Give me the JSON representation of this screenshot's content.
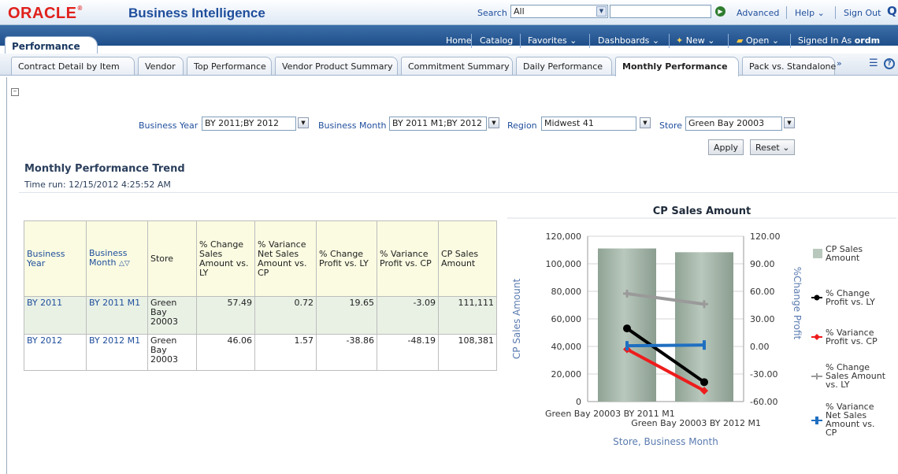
{
  "header": {
    "logo": "ORACLE",
    "logo_mark": "®",
    "title": "Business Intelligence",
    "search_label": "Search",
    "search_scope": "All",
    "links": [
      "Advanced",
      "Help ⌄",
      "Sign Out"
    ]
  },
  "nav": {
    "dashboard_tab": "Performance",
    "links": [
      "Home",
      "Catalog",
      "Favorites ⌄",
      "Dashboards ⌄",
      "New ⌄",
      "Open ⌄"
    ],
    "signed_in_label": "Signed In As",
    "signed_in_user": "ordm"
  },
  "page_tabs": [
    "Contract Detail by Item",
    "Vendor",
    "Top Performance",
    "Vendor Product Summary",
    "Commitment Summary",
    "Daily Performance",
    "Monthly Performance",
    "Pack vs. Standalone"
  ],
  "active_tab": "Monthly Performance",
  "more_tabs": "»",
  "prompts": {
    "business_year": {
      "label": "Business Year",
      "value": "BY 2011;BY 2012"
    },
    "business_month": {
      "label": "Business Month",
      "value": "BY 2011 M1;BY 2012"
    },
    "region": {
      "label": "Region",
      "value": "Midwest 41"
    },
    "store": {
      "label": "Store",
      "value": "Green Bay 20003"
    },
    "apply": "Apply",
    "reset": "Reset ⌄"
  },
  "report": {
    "title": "Monthly Performance Trend",
    "time_run": "Time run: 12/15/2012 4:25:52 AM"
  },
  "table": {
    "columns": [
      "Business Year",
      "Business Month",
      "Store",
      "% Change Sales Amount vs. LY",
      "% Variance Net Sales Amount vs. CP",
      "% Change Profit vs. LY",
      "% Variance Profit vs. CP",
      "CP Sales Amount"
    ],
    "rows": [
      [
        "BY 2011",
        "BY 2011 M1",
        "Green Bay 20003",
        "57.49",
        "0.72",
        "19.65",
        "-3.09",
        "111,111"
      ],
      [
        "BY 2012",
        "BY 2012 M1",
        "Green Bay 20003",
        "46.06",
        "1.57",
        "-38.86",
        "-48.19",
        "108,381"
      ]
    ]
  },
  "chart_data": {
    "type": "bar",
    "title": "CP Sales Amount",
    "xlabel": "Store, Business Month",
    "ylabel": "CP Sales Amount",
    "y2label": "%Change Profit",
    "categories": [
      "Green Bay 20003 BY 2011 M1",
      "Green Bay 20003 BY 2012 M1"
    ],
    "ylim": [
      0,
      120000
    ],
    "yticks": [
      "0",
      "20,000",
      "40,000",
      "60,000",
      "80,000",
      "100,000",
      "120,000"
    ],
    "y2lim": [
      -60,
      120
    ],
    "y2ticks": [
      "-60.00",
      "-30.00",
      "0.00",
      "30.00",
      "60.00",
      "90.00",
      "120.00"
    ],
    "bars": {
      "name": "CP Sales Amount",
      "values": [
        111111,
        108381
      ],
      "color": "#b9c8bd"
    },
    "lines": [
      {
        "name": "% Change Profit vs. LY",
        "values": [
          19.65,
          -38.86
        ],
        "color": "#000000"
      },
      {
        "name": "% Variance Profit vs. CP",
        "values": [
          -3.09,
          -48.19
        ],
        "color": "#ee1c1c"
      },
      {
        "name": "% Change Sales Amount vs. LY",
        "values": [
          57.49,
          46.06
        ],
        "color": "#9a9a9a"
      },
      {
        "name": "% Variance Net Sales Amount vs. CP",
        "values": [
          0.72,
          1.57
        ],
        "color": "#1f6fc1"
      }
    ],
    "legend_position": "right",
    "grid": true
  },
  "colors": {
    "oracle_red": "#e0201b",
    "header_blue": "#1f4e9c",
    "nav_blue": "#2a5c9a"
  }
}
